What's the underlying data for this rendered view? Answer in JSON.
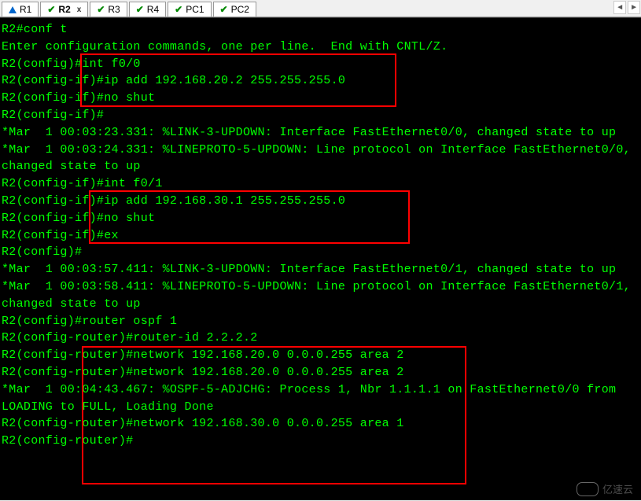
{
  "tabs": [
    {
      "label": "R1",
      "active": false,
      "icon": "warning"
    },
    {
      "label": "R2",
      "active": true,
      "icon": "check"
    },
    {
      "label": "R3",
      "active": false,
      "icon": "check"
    },
    {
      "label": "R4",
      "active": false,
      "icon": "check"
    },
    {
      "label": "PC1",
      "active": false,
      "icon": "check"
    },
    {
      "label": "PC2",
      "active": false,
      "icon": "check"
    }
  ],
  "terminal_lines": [
    "R2#conf t",
    "Enter configuration commands, one per line.  End with CNTL/Z.",
    "R2(config)#int f0/0",
    "R2(config-if)#ip add 192.168.20.2 255.255.255.0",
    "R2(config-if)#no shut",
    "R2(config-if)#",
    "*Mar  1 00:03:23.331: %LINK-3-UPDOWN: Interface FastEthernet0/0, changed state to up",
    "*Mar  1 00:03:24.331: %LINEPROTO-5-UPDOWN: Line protocol on Interface FastEthernet0/0, changed state to up",
    "R2(config-if)#int f0/1",
    "R2(config-if)#ip add 192.168.30.1 255.255.255.0",
    "R2(config-if)#no shut",
    "R2(config-if)#ex",
    "R2(config)#",
    "*Mar  1 00:03:57.411: %LINK-3-UPDOWN: Interface FastEthernet0/1, changed state to up",
    "*Mar  1 00:03:58.411: %LINEPROTO-5-UPDOWN: Line protocol on Interface FastEthernet0/1, changed state to up",
    "R2(config)#router ospf 1",
    "R2(config-router)#router-id 2.2.2.2",
    "R2(config-router)#network 192.168.20.0 0.0.0.255 area 2",
    "R2(config-router)#network 192.168.20.0 0.0.0.255 area 2",
    "*Mar  1 00:04:43.467: %OSPF-5-ADJCHG: Process 1, Nbr 1.1.1.1 on FastEthernet0/0 from LOADING to FULL, Loading Done",
    "R2(config-router)#network 192.168.30.0 0.0.0.255 area 1",
    "R2(config-router)#"
  ],
  "watermark_text": "亿速云",
  "close_label": "x"
}
